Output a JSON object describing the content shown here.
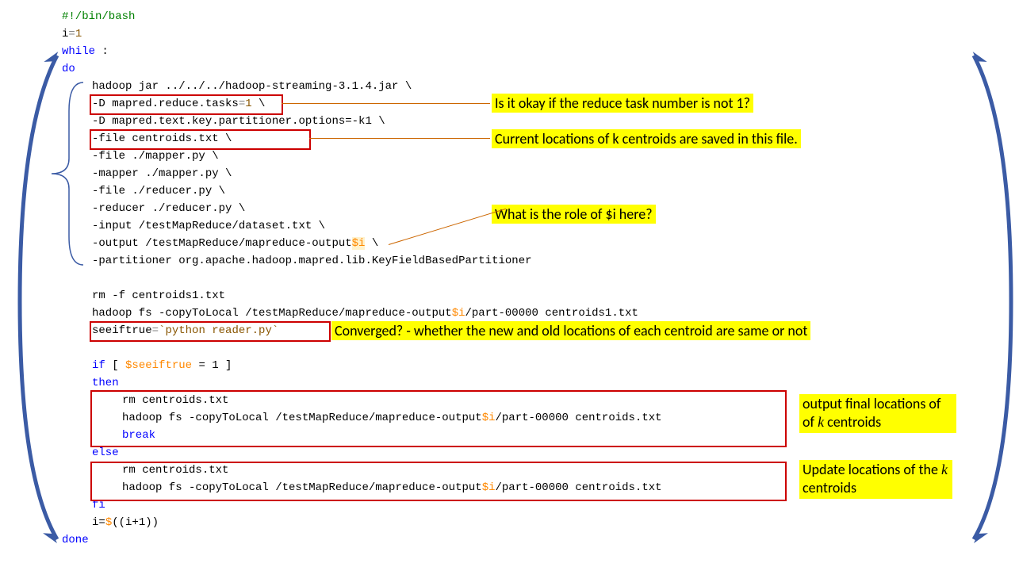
{
  "code": {
    "l1_shebang": "#!/bin/bash",
    "l2_a": "i",
    "l2_b": "=",
    "l2_c": "1",
    "l3": "while",
    "l3_colon": " :",
    "l4": "do",
    "l5": "hadoop jar ../../../hadoop-streaming-3.1.4.jar \\",
    "l6_pre": "-D mapred.reduce.tasks",
    "l6_eq": "=",
    "l6_val": "1",
    "l6_tail": " \\",
    "l7": "-D mapred.text.key.partitioner.options=-k1 \\",
    "l8": "-file centroids.txt \\",
    "l9": "-file ./mapper.py \\",
    "l10": "-mapper ./mapper.py \\",
    "l11": "-file ./reducer.py \\",
    "l12": "-reducer ./reducer.py \\",
    "l13": "-input /testMapReduce/dataset.txt \\",
    "l14_pre": "-output /testMapReduce/mapreduce-output",
    "l14_var": "$i",
    "l14_tail": " \\",
    "l15": "-partitioner org.apache.hadoop.mapred.lib.KeyFieldBasedPartitioner",
    "l16": "",
    "l17": "rm -f centroids1.txt",
    "l18_pre": "hadoop fs -copyToLocal /testMapReduce/mapreduce-output",
    "l18_var": "$i",
    "l18_tail": "/part-00000 centroids1.txt",
    "l19_var": "seeiftrue",
    "l19_eq": "=",
    "l19_bt1": "`",
    "l19_cmd": "python reader.py",
    "l19_bt2": "`",
    "l20": "",
    "l21_if": "if",
    "l21_rest": " [ ",
    "l21_var": "$seeiftrue",
    "l21_tail": " = 1 ]",
    "l22": "then",
    "l23": "rm centroids.txt",
    "l24_pre": "hadoop fs -copyToLocal /testMapReduce/mapreduce-output",
    "l24_var": "$i",
    "l24_tail": "/part-00000 centroids.txt",
    "l25": "break",
    "l26": "else",
    "l27": "rm centroids.txt",
    "l28_pre": "hadoop fs -copyToLocal /testMapReduce/mapreduce-output",
    "l28_var": "$i",
    "l28_tail": "/part-00000 centroids.txt",
    "l29": "fi",
    "l30_pre": "i=",
    "l30_var": "$",
    "l30_expr": "((i+1))",
    "l31": "done"
  },
  "annotations": {
    "a1": "Is it okay if the reduce task number is not 1?",
    "a2": "Current locations of k centroids are saved in this file.",
    "a3": "What is the role of $i here?",
    "a4": "Converged? - whether the new and old locations of each centroid are same or not",
    "a5": "output final locations of ",
    "a5b": " centroids",
    "a6": "Update locations of the ",
    "a6b": " centroids",
    "k": "k"
  }
}
